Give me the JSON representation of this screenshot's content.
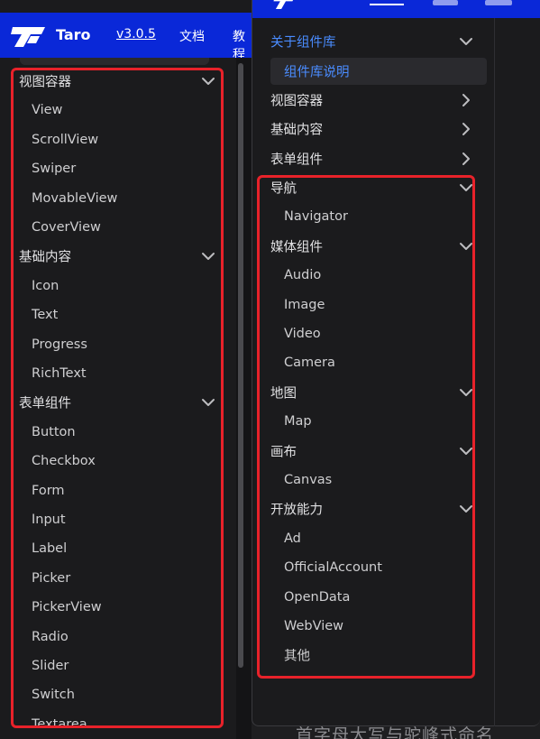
{
  "left_window": {
    "brand": "Taro",
    "version": "v3.0.5",
    "docs_link": "文档",
    "tutorial_link": "教程",
    "sidebar": [
      {
        "label": "视图容器",
        "type": "group",
        "chevron": "down"
      },
      {
        "label": "View",
        "type": "item"
      },
      {
        "label": "ScrollView",
        "type": "item"
      },
      {
        "label": "Swiper",
        "type": "item"
      },
      {
        "label": "MovableView",
        "type": "item"
      },
      {
        "label": "CoverView",
        "type": "item"
      },
      {
        "label": "基础内容",
        "type": "group",
        "chevron": "down"
      },
      {
        "label": "Icon",
        "type": "item"
      },
      {
        "label": "Text",
        "type": "item"
      },
      {
        "label": "Progress",
        "type": "item"
      },
      {
        "label": "RichText",
        "type": "item"
      },
      {
        "label": "表单组件",
        "type": "group",
        "chevron": "down"
      },
      {
        "label": "Button",
        "type": "item"
      },
      {
        "label": "Checkbox",
        "type": "item"
      },
      {
        "label": "Form",
        "type": "item"
      },
      {
        "label": "Input",
        "type": "item"
      },
      {
        "label": "Label",
        "type": "item"
      },
      {
        "label": "Picker",
        "type": "item"
      },
      {
        "label": "PickerView",
        "type": "item"
      },
      {
        "label": "Radio",
        "type": "item"
      },
      {
        "label": "Slider",
        "type": "item"
      },
      {
        "label": "Switch",
        "type": "item"
      },
      {
        "label": "Textarea",
        "type": "item"
      }
    ]
  },
  "right_window": {
    "sidebar": [
      {
        "label": "关于组件库",
        "type": "group",
        "chevron": "down",
        "active": true
      },
      {
        "label": "组件库说明",
        "type": "selected"
      },
      {
        "label": "视图容器",
        "type": "group",
        "chevron": "right"
      },
      {
        "label": "基础内容",
        "type": "group",
        "chevron": "right"
      },
      {
        "label": "表单组件",
        "type": "group",
        "chevron": "right"
      },
      {
        "label": "导航",
        "type": "group",
        "chevron": "down"
      },
      {
        "label": "Navigator",
        "type": "item"
      },
      {
        "label": "媒体组件",
        "type": "group",
        "chevron": "down"
      },
      {
        "label": "Audio",
        "type": "item"
      },
      {
        "label": "Image",
        "type": "item"
      },
      {
        "label": "Video",
        "type": "item"
      },
      {
        "label": "Camera",
        "type": "item"
      },
      {
        "label": "地图",
        "type": "group",
        "chevron": "down"
      },
      {
        "label": "Map",
        "type": "item"
      },
      {
        "label": "画布",
        "type": "group",
        "chevron": "down"
      },
      {
        "label": "Canvas",
        "type": "item"
      },
      {
        "label": "开放能力",
        "type": "group",
        "chevron": "down"
      },
      {
        "label": "Ad",
        "type": "item"
      },
      {
        "label": "OfficialAccount",
        "type": "item"
      },
      {
        "label": "OpenData",
        "type": "item"
      },
      {
        "label": "WebView",
        "type": "item"
      },
      {
        "label": "其他",
        "type": "item"
      }
    ]
  },
  "background_text": "首字母大写与驼峰式命名",
  "colors": {
    "header_blue": "#0a28d8",
    "sidebar_bg": "#1b1b1d",
    "active_blue": "#4a8cff",
    "annotation_red": "#e8222a"
  }
}
